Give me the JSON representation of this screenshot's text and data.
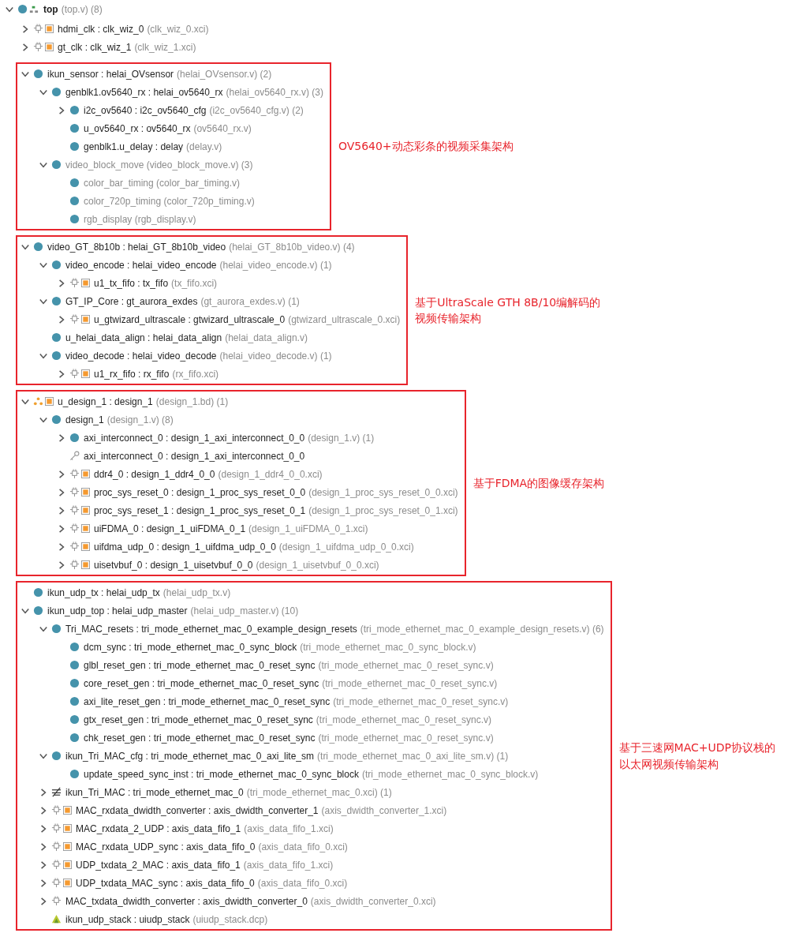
{
  "root": {
    "kind": "top",
    "label": "top",
    "detail": "(top.v) (8)",
    "expanded": true
  },
  "sections": [
    {
      "boxed": false,
      "items": [
        {
          "kind": "ip",
          "label": "hdmi_clk : clk_wiz_0",
          "detail": "(clk_wiz_0.xci)",
          "expanded": false
        },
        {
          "kind": "ip",
          "label": "gt_clk : clk_wiz_1",
          "detail": "(clk_wiz_1.xci)",
          "expanded": false
        }
      ]
    },
    {
      "boxed": true,
      "note_lines": [
        "OV5640+动态彩条的视频采集架构"
      ],
      "items": [
        {
          "kind": "module",
          "label": "ikun_sensor : helai_OVsensor",
          "detail": "(helai_OVsensor.v) (2)",
          "expanded": true,
          "children": [
            {
              "kind": "module",
              "label": "genblk1.ov5640_rx : helai_ov5640_rx",
              "detail": "(helai_ov5640_rx.v) (3)",
              "expanded": true,
              "children": [
                {
                  "kind": "module",
                  "label": "i2c_ov5640 : i2c_ov5640_cfg",
                  "detail": "(i2c_ov5640_cfg.v) (2)",
                  "expanded": false
                },
                {
                  "kind": "module",
                  "label": "u_ov5640_rx : ov5640_rx",
                  "detail": "(ov5640_rx.v)"
                },
                {
                  "kind": "module",
                  "label": "genblk1.u_delay : delay",
                  "detail": "(delay.v)"
                }
              ]
            },
            {
              "kind": "module",
              "detail": "video_block_move (video_block_move.v) (3)",
              "expanded": true,
              "children": [
                {
                  "kind": "module",
                  "detail": "color_bar_timing (color_bar_timing.v)"
                },
                {
                  "kind": "module",
                  "detail": "color_720p_timing (color_720p_timing.v)"
                },
                {
                  "kind": "module",
                  "detail": "rgb_display (rgb_display.v)"
                }
              ]
            }
          ]
        }
      ]
    },
    {
      "boxed": true,
      "note_lines": [
        "基于UltraScale GTH 8B/10编解码的",
        "视频传输架构"
      ],
      "items": [
        {
          "kind": "module",
          "label": "video_GT_8b10b : helai_GT_8b10b_video",
          "detail": "(helai_GT_8b10b_video.v) (4)",
          "expanded": true,
          "children": [
            {
              "kind": "module",
              "label": "video_encode : helai_video_encode",
              "detail": "(helai_video_encode.v) (1)",
              "expanded": true,
              "children": [
                {
                  "kind": "ip",
                  "label": "u1_tx_fifo : tx_fifo",
                  "detail": "(tx_fifo.xci)",
                  "expanded": false
                }
              ]
            },
            {
              "kind": "module",
              "label": "GT_IP_Core : gt_aurora_exdes",
              "detail": "(gt_aurora_exdes.v) (1)",
              "expanded": true,
              "children": [
                {
                  "kind": "ip",
                  "label": "u_gtwizard_ultrascale : gtwizard_ultrascale_0",
                  "detail": "(gtwizard_ultrascale_0.xci)",
                  "expanded": false
                }
              ]
            },
            {
              "kind": "module",
              "label": "u_helai_data_align : helai_data_align",
              "detail": "(helai_data_align.v)"
            },
            {
              "kind": "module",
              "label": "video_decode : helai_video_decode",
              "detail": "(helai_video_decode.v) (1)",
              "expanded": true,
              "children": [
                {
                  "kind": "ip",
                  "label": "u1_rx_fifo : rx_fifo",
                  "detail": "(rx_fifo.xci)",
                  "expanded": false
                }
              ]
            }
          ]
        }
      ]
    },
    {
      "boxed": true,
      "note_lines": [
        "基于FDMA的图像缓存架构"
      ],
      "items": [
        {
          "kind": "bd",
          "label": "u_design_1 : design_1",
          "detail": "(design_1.bd) (1)",
          "expanded": true,
          "children": [
            {
              "kind": "module",
              "label": "design_1",
              "detail": "(design_1.v) (8)",
              "expanded": true,
              "children": [
                {
                  "kind": "module",
                  "label": "axi_interconnect_0 : design_1_axi_interconnect_0_0",
                  "detail": "(design_1.v) (1)",
                  "expanded": false
                },
                {
                  "kind": "key",
                  "label": "axi_interconnect_0 : design_1_axi_interconnect_0_0"
                },
                {
                  "kind": "ip",
                  "label": "ddr4_0 : design_1_ddr4_0_0",
                  "detail": "(design_1_ddr4_0_0.xci)",
                  "expanded": false
                },
                {
                  "kind": "ip",
                  "label": "proc_sys_reset_0 : design_1_proc_sys_reset_0_0",
                  "detail": "(design_1_proc_sys_reset_0_0.xci)",
                  "expanded": false
                },
                {
                  "kind": "ip",
                  "label": "proc_sys_reset_1 : design_1_proc_sys_reset_0_1",
                  "detail": "(design_1_proc_sys_reset_0_1.xci)",
                  "expanded": false
                },
                {
                  "kind": "ip",
                  "label": "uiFDMA_0 : design_1_uiFDMA_0_1",
                  "detail": "(design_1_uiFDMA_0_1.xci)",
                  "expanded": false
                },
                {
                  "kind": "ip",
                  "label": "uifdma_udp_0 : design_1_uifdma_udp_0_0",
                  "detail": "(design_1_uifdma_udp_0_0.xci)",
                  "expanded": false
                },
                {
                  "kind": "ip",
                  "label": "uisetvbuf_0 : design_1_uisetvbuf_0_0",
                  "detail": "(design_1_uisetvbuf_0_0.xci)",
                  "expanded": false
                }
              ]
            }
          ]
        }
      ]
    },
    {
      "boxed": true,
      "note_lines": [
        "基于三速网MAC+UDP协议栈的",
        "以太网视频传输架构"
      ],
      "items": [
        {
          "kind": "module",
          "label": "ikun_udp_tx : helai_udp_tx",
          "detail": "(helai_udp_tx.v)"
        },
        {
          "kind": "module",
          "label": "ikun_udp_top : helai_udp_master",
          "detail": "(helai_udp_master.v) (10)",
          "expanded": true,
          "children": [
            {
              "kind": "module",
              "label": "Tri_MAC_resets : tri_mode_ethernet_mac_0_example_design_resets",
              "detail": "(tri_mode_ethernet_mac_0_example_design_resets.v) (6)",
              "expanded": true,
              "children": [
                {
                  "kind": "module",
                  "label": "dcm_sync : tri_mode_ethernet_mac_0_sync_block",
                  "detail": "(tri_mode_ethernet_mac_0_sync_block.v)"
                },
                {
                  "kind": "module",
                  "label": "glbl_reset_gen : tri_mode_ethernet_mac_0_reset_sync",
                  "detail": "(tri_mode_ethernet_mac_0_reset_sync.v)"
                },
                {
                  "kind": "module",
                  "label": "core_reset_gen : tri_mode_ethernet_mac_0_reset_sync",
                  "detail": "(tri_mode_ethernet_mac_0_reset_sync.v)"
                },
                {
                  "kind": "module",
                  "label": "axi_lite_reset_gen : tri_mode_ethernet_mac_0_reset_sync",
                  "detail": "(tri_mode_ethernet_mac_0_reset_sync.v)"
                },
                {
                  "kind": "module",
                  "label": "gtx_reset_gen : tri_mode_ethernet_mac_0_reset_sync",
                  "detail": "(tri_mode_ethernet_mac_0_reset_sync.v)"
                },
                {
                  "kind": "module",
                  "label": "chk_reset_gen : tri_mode_ethernet_mac_0_reset_sync",
                  "detail": "(tri_mode_ethernet_mac_0_reset_sync.v)"
                }
              ]
            },
            {
              "kind": "module",
              "label": "ikun_Tri_MAC_cfg : tri_mode_ethernet_mac_0_axi_lite_sm",
              "detail": "(tri_mode_ethernet_mac_0_axi_lite_sm.v) (1)",
              "expanded": true,
              "children": [
                {
                  "kind": "module",
                  "label": "update_speed_sync_inst : tri_mode_ethernet_mac_0_sync_block",
                  "detail": "(tri_mode_ethernet_mac_0_sync_block.v)"
                }
              ]
            },
            {
              "kind": "mac",
              "label": "ikun_Tri_MAC : tri_mode_ethernet_mac_0",
              "detail": "(tri_mode_ethernet_mac_0.xci) (1)",
              "expanded": false
            },
            {
              "kind": "ip",
              "label": "MAC_rxdata_dwidth_converter : axis_dwidth_converter_1",
              "detail": "(axis_dwidth_converter_1.xci)",
              "expanded": false
            },
            {
              "kind": "ip",
              "label": "MAC_rxdata_2_UDP : axis_data_fifo_1",
              "detail": "(axis_data_fifo_1.xci)",
              "expanded": false
            },
            {
              "kind": "ip",
              "label": "MAC_rxdata_UDP_sync : axis_data_fifo_0",
              "detail": "(axis_data_fifo_0.xci)",
              "expanded": false
            },
            {
              "kind": "ip",
              "label": "UDP_txdata_2_MAC : axis_data_fifo_1",
              "detail": "(axis_data_fifo_1.xci)",
              "expanded": false
            },
            {
              "kind": "ip",
              "label": "UDP_txdata_MAC_sync : axis_data_fifo_0",
              "detail": "(axis_data_fifo_0.xci)",
              "expanded": false
            },
            {
              "kind": "chip",
              "label": "MAC_txdata_dwidth_converter : axis_dwidth_converter_0",
              "detail": "(axis_dwidth_converter_0.xci)",
              "expanded": false
            },
            {
              "kind": "dcp",
              "label": "ikun_udp_stack : uiudp_stack",
              "detail": "(uiudp_stack.dcp)"
            }
          ]
        }
      ]
    }
  ]
}
